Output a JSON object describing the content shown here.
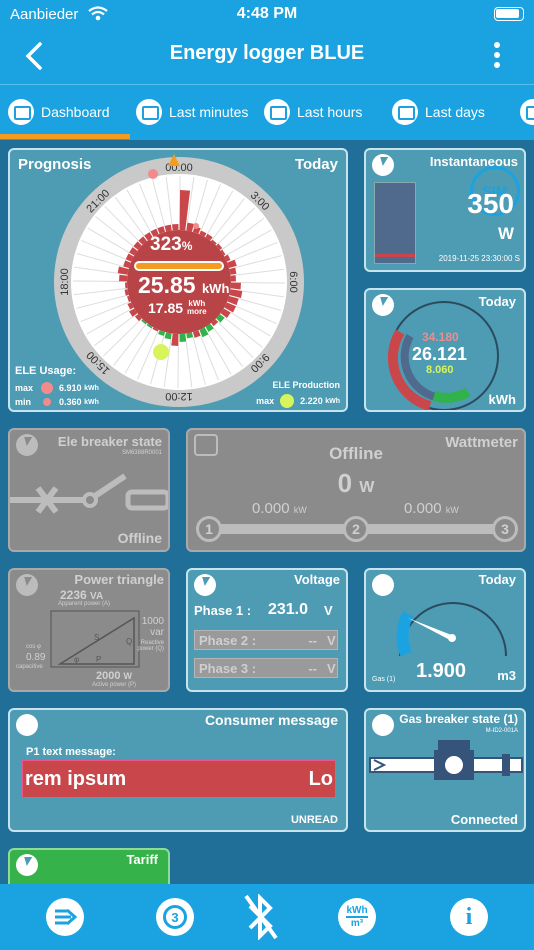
{
  "status": {
    "carrier": "Aanbieder",
    "time": "4:48 PM"
  },
  "nav": {
    "title": "Energy logger BLUE"
  },
  "tabs": [
    {
      "label": "Dashboard"
    },
    {
      "label": "Last minutes"
    },
    {
      "label": "Last hours"
    },
    {
      "label": "Last days"
    }
  ],
  "prognosis": {
    "title": "Prognosis",
    "period": "Today",
    "hours": [
      "00:00",
      "3:00",
      "6:00",
      "9:00",
      "12:00",
      "15:00",
      "18:00",
      "21:00"
    ],
    "percent": "323",
    "percent_unit": "%",
    "kwh": "25.85",
    "kwh_unit": "kWh",
    "more": "17.85",
    "more_unit_1": "kWh",
    "more_unit_2": "more",
    "usage_label": "ELE Usage:",
    "max_label": "max",
    "max_value": "6.910",
    "min_label": "min",
    "min_value": "0.360",
    "unit_kwh": "kWh",
    "production_label": "ELE Production",
    "prod_max_label": "max",
    "prod_max_value": "2.220",
    "colors": {
      "usage": "#c9474a",
      "production": "#31b24a"
    }
  },
  "instantaneous": {
    "title": "Instantaneous",
    "badge": "SIM",
    "value": "350",
    "unit": "W",
    "timestamp": "2019-11-25 23:30:00 S"
  },
  "today_kwh": {
    "title": "Today",
    "usage": "34.180",
    "net": "26.121",
    "production": "8.060",
    "unit": "kWh"
  },
  "breaker": {
    "title": "Ele breaker state",
    "serial": "SM6388R0001",
    "state": "Offline"
  },
  "wattmeter": {
    "title": "Wattmeter",
    "state": "Offline",
    "value": "0",
    "unit": "W",
    "left_value": "0.000",
    "left_unit": "kW",
    "right_value": "0.000",
    "right_unit": "kW",
    "nodes": [
      "1",
      "2",
      "3"
    ]
  },
  "power_triangle": {
    "title": "Power triangle",
    "apparent_value": "2236",
    "apparent_unit": "VA",
    "apparent_label": "Apparent power (A)",
    "reactive_value": "1000",
    "reactive_unit": "var",
    "reactive_label_1": "Reactive",
    "reactive_label_2": "power (Q)",
    "cos_label": "cos φ",
    "cos_value": "0.89",
    "cos_note": "capacitive",
    "active_value": "2000",
    "active_unit": "W",
    "active_label": "Active power (P)",
    "side_s": "S",
    "side_q": "Q",
    "side_p": "P",
    "angle": "φ"
  },
  "voltage": {
    "title": "Voltage",
    "phases": [
      {
        "label": "Phase 1 :",
        "value": "231.0",
        "unit": "V"
      },
      {
        "label": "Phase 2 :",
        "value": "--",
        "unit": "V"
      },
      {
        "label": "Phase 3 :",
        "value": "--",
        "unit": "V"
      }
    ]
  },
  "gas_today": {
    "title": "Today",
    "value": "1.900",
    "unit": "m3",
    "label": "Gas (1)",
    "gauge_fraction": 0.25
  },
  "consumer": {
    "title": "Consumer message",
    "subtitle": "P1 text message:",
    "text_left": "rem ipsum",
    "text_right": "Lo",
    "status": "UNREAD"
  },
  "gas_breaker": {
    "title": "Gas breaker state (1)",
    "serial": "M-ID2-001A",
    "state": "Connected"
  },
  "tariff": {
    "title": "Tariff"
  },
  "bottom": {
    "icons": [
      "arrow-menu-icon",
      "search-3-icon",
      "bluetooth-off-icon",
      "kwh-m3-icon",
      "info-icon"
    ],
    "kwh_top": "kWh",
    "kwh_bottom": "m³",
    "search_num": "3",
    "info": "i"
  }
}
